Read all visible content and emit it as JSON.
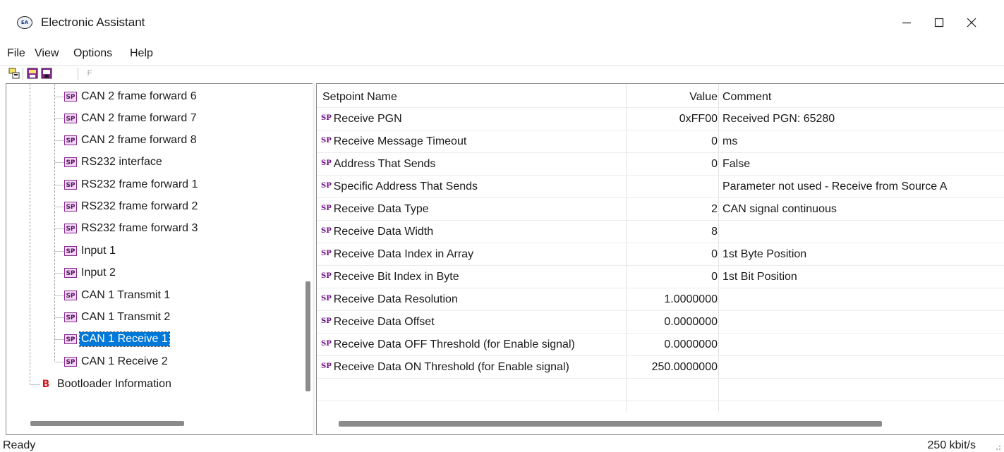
{
  "window": {
    "title": "Electronic Assistant",
    "app_icon_text": "EA",
    "icons": {
      "minimize": "minimize-icon",
      "maximize": "maximize-icon",
      "close": "close-icon"
    }
  },
  "menu": [
    "File",
    "View",
    "Options",
    "Help"
  ],
  "toolbar": {
    "buttons": [
      "connect-icon",
      "read-setpoints-icon",
      "write-setpoints-icon"
    ],
    "f_label": "F"
  },
  "tree": {
    "sp_badge": "SP",
    "b_badge": "B",
    "items": [
      "CAN 2 frame forward 6",
      "CAN 2 frame forward 7",
      "CAN 2 frame forward 8",
      "RS232 interface",
      "RS232 frame forward 1",
      "RS232 frame forward 2",
      "RS232 frame forward 3",
      "Input 1",
      "Input 2",
      "CAN 1 Transmit 1",
      "CAN 1 Transmit 2",
      "CAN 1 Receive 1",
      "CAN 1 Receive 2"
    ],
    "selected": "CAN 1 Receive 1",
    "bootloader": "Bootloader Information"
  },
  "table": {
    "sp_badge": "SP",
    "headers": {
      "name": "Setpoint Name",
      "value": "Value",
      "comment": "Comment"
    },
    "rows": [
      {
        "name": "Receive PGN",
        "value": "0xFF00",
        "comment": "Received PGN: 65280"
      },
      {
        "name": "Receive Message Timeout",
        "value": "0",
        "comment": "ms"
      },
      {
        "name": "Address That Sends",
        "value": "0",
        "comment": "False"
      },
      {
        "name": "Specific Address That Sends",
        "value": "",
        "comment": "Parameter not used - Receive from Source A"
      },
      {
        "name": "Receive Data Type",
        "value": "2",
        "comment": "CAN signal continuous"
      },
      {
        "name": "Receive Data Width",
        "value": "8",
        "comment": ""
      },
      {
        "name": "Receive Data Index in Array",
        "value": "0",
        "comment": "1st Byte Position"
      },
      {
        "name": "Receive Bit Index in Byte",
        "value": "0",
        "comment": "1st Bit Position"
      },
      {
        "name": "Receive Data Resolution",
        "value": "1.0000000",
        "comment": ""
      },
      {
        "name": "Receive Data Offset",
        "value": "0.0000000",
        "comment": ""
      },
      {
        "name": "Receive Data OFF Threshold (for Enable signal)",
        "value": "0.0000000",
        "comment": ""
      },
      {
        "name": "Receive Data ON Threshold (for Enable signal)",
        "value": "250.0000000",
        "comment": ""
      }
    ]
  },
  "status": {
    "left": "Ready",
    "right": "250 kbit/s"
  },
  "colors": {
    "selection": "#0078d7",
    "sp_badge": "#6a0f80",
    "b_badge": "#d41a1a"
  }
}
